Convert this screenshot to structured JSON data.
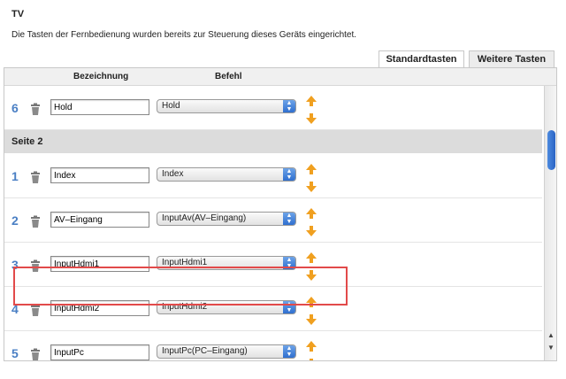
{
  "page": {
    "title": "TV",
    "description": "Die Tasten der Fernbedienung wurden bereits zur Steuerung dieses Geräts eingerichtet."
  },
  "tabs": [
    {
      "label": "Standardtasten",
      "active": false
    },
    {
      "label": "Weitere Tasten",
      "active": true
    }
  ],
  "columns": {
    "name": "Bezeichnung",
    "command": "Befehl"
  },
  "rows": [
    {
      "num": "6",
      "name": "Hold",
      "command": "Hold"
    },
    {
      "num": "1",
      "name": "Index",
      "command": "Index"
    },
    {
      "num": "2",
      "name": "AV–Eingang",
      "command": "InputAv(AV–Eingang)"
    },
    {
      "num": "3",
      "name": "InputHdmi1",
      "command": "InputHdmi1"
    },
    {
      "num": "4",
      "name": "InputHdmi2",
      "command": "InputHdmi2"
    },
    {
      "num": "5",
      "name": "InputPc",
      "command": "InputPc(PC–Eingang)"
    }
  ],
  "section": {
    "label": "Seite 2"
  },
  "colors": {
    "accent": "#4a7fc4",
    "highlight": "#e24a4a",
    "arrow": "#f0a020"
  },
  "icons": [
    "trash-icon",
    "arrow-up-icon",
    "arrow-down-icon",
    "select-arrows-icon"
  ]
}
